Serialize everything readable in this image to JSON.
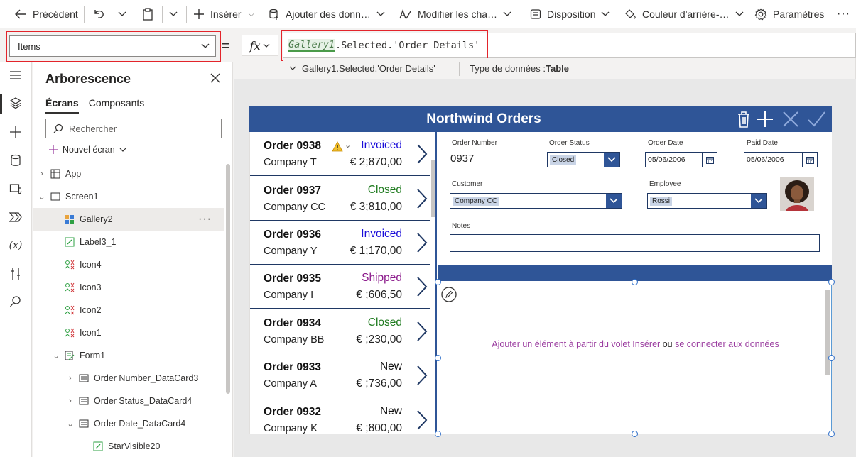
{
  "toolbar": {
    "back": "Précédent",
    "insert": "Insérer",
    "add_data": "Ajouter des donn…",
    "edit_fields": "Modifier les cha…",
    "layout": "Disposition",
    "background_color": "Couleur d'arrière-…",
    "settings": "Paramètres"
  },
  "formula_bar": {
    "property": "Items",
    "equals": "=",
    "fx": "fx",
    "formula_token": "Gallery1",
    "formula_rest": ".Selected.'Order Details'",
    "hint_expression": "Gallery1.Selected.'Order Details'",
    "hint_type_label": "Type de données :",
    "hint_type_value": "Table"
  },
  "tree_view": {
    "title": "Arborescence",
    "tabs": [
      "Écrans",
      "Composants"
    ],
    "search_placeholder": "Rechercher",
    "new_screen": "Nouvel écran",
    "nodes": [
      {
        "label": "App"
      },
      {
        "label": "Screen1"
      },
      {
        "label": "Gallery2"
      },
      {
        "label": "Label3_1"
      },
      {
        "label": "Icon4"
      },
      {
        "label": "Icon3"
      },
      {
        "label": "Icon2"
      },
      {
        "label": "Icon1"
      },
      {
        "label": "Form1"
      },
      {
        "label": "Order Number_DataCard3"
      },
      {
        "label": "Order Status_DataCard4"
      },
      {
        "label": "Order Date_DataCard4"
      },
      {
        "label": "StarVisible20"
      }
    ]
  },
  "app": {
    "title": "Northwind Orders",
    "orders": [
      {
        "order": "Order 0938",
        "company": "Company T",
        "status": "Invoiced",
        "amount": "€ 2;870,00",
        "status_color": "#1a0dd9"
      },
      {
        "order": "Order 0937",
        "company": "Company CC",
        "status": "Closed",
        "amount": "€ 3;810,00",
        "status_color": "#1e7a1e"
      },
      {
        "order": "Order 0936",
        "company": "Company Y",
        "status": "Invoiced",
        "amount": "€ 1;170,00",
        "status_color": "#1a0dd9"
      },
      {
        "order": "Order 0935",
        "company": "Company I",
        "status": "Shipped",
        "amount": "€ ;606,50",
        "status_color": "#8b1a8b"
      },
      {
        "order": "Order 0934",
        "company": "Company BB",
        "status": "Closed",
        "amount": "€ ;230,00",
        "status_color": "#1e7a1e"
      },
      {
        "order": "Order 0933",
        "company": "Company A",
        "status": "New",
        "amount": "€ ;736,00",
        "status_color": "#111111"
      },
      {
        "order": "Order 0932",
        "company": "Company K",
        "status": "New",
        "amount": "€ ;800,00",
        "status_color": "#111111"
      }
    ],
    "form": {
      "order_number_label": "Order Number",
      "order_number": "0937",
      "order_status_label": "Order Status",
      "order_status": "Closed",
      "order_date_label": "Order Date",
      "order_date": "05/06/2006",
      "paid_date_label": "Paid Date",
      "paid_date": "05/06/2006",
      "customer_label": "Customer",
      "customer": "Company CC",
      "employee_label": "Employee",
      "employee": "Rossi",
      "notes_label": "Notes"
    },
    "empty_message_link1": "Ajouter un élément à partir du volet Insérer",
    "empty_message_or": " ou ",
    "empty_message_link2": "se connecter aux données"
  },
  "colors": {
    "brand_blue": "#2f5597",
    "highlight_red": "#e3242b"
  }
}
